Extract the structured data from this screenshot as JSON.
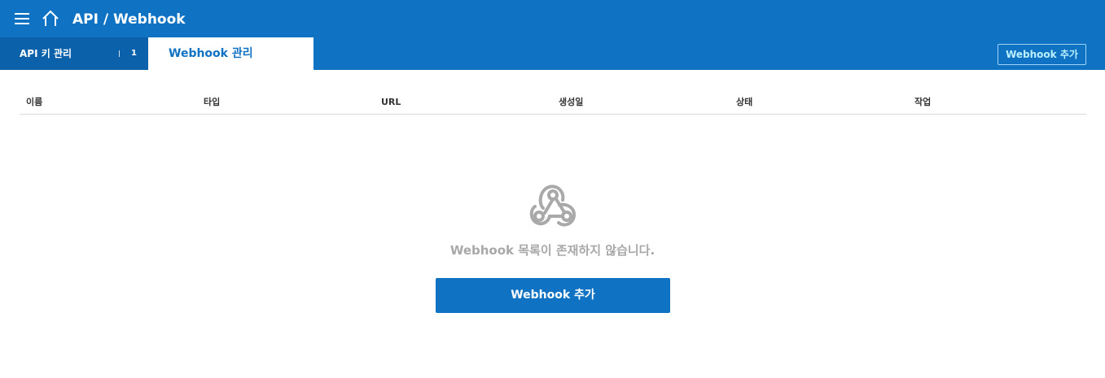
{
  "header": {
    "title": "API / Webhook",
    "menu_icon": "hamburger-menu-icon",
    "home_icon": "home-icon"
  },
  "tabs": [
    {
      "label": "API 키 관리",
      "count": "1",
      "active": false
    },
    {
      "label": "Webhook 관리",
      "active": true
    }
  ],
  "toolbar": {
    "add_label": "Webhook 추가"
  },
  "table": {
    "columns": [
      "이름",
      "타입",
      "URL",
      "생성일",
      "상태",
      "작업"
    ],
    "rows": []
  },
  "empty_state": {
    "icon": "webhook-icon",
    "message": "Webhook 목록이 존재하지 않습니다.",
    "button_label": "Webhook 추가"
  },
  "colors": {
    "primary": "#0f72c2",
    "tab_inactive": "#0b62aa",
    "empty_text": "#a8a8a8"
  }
}
